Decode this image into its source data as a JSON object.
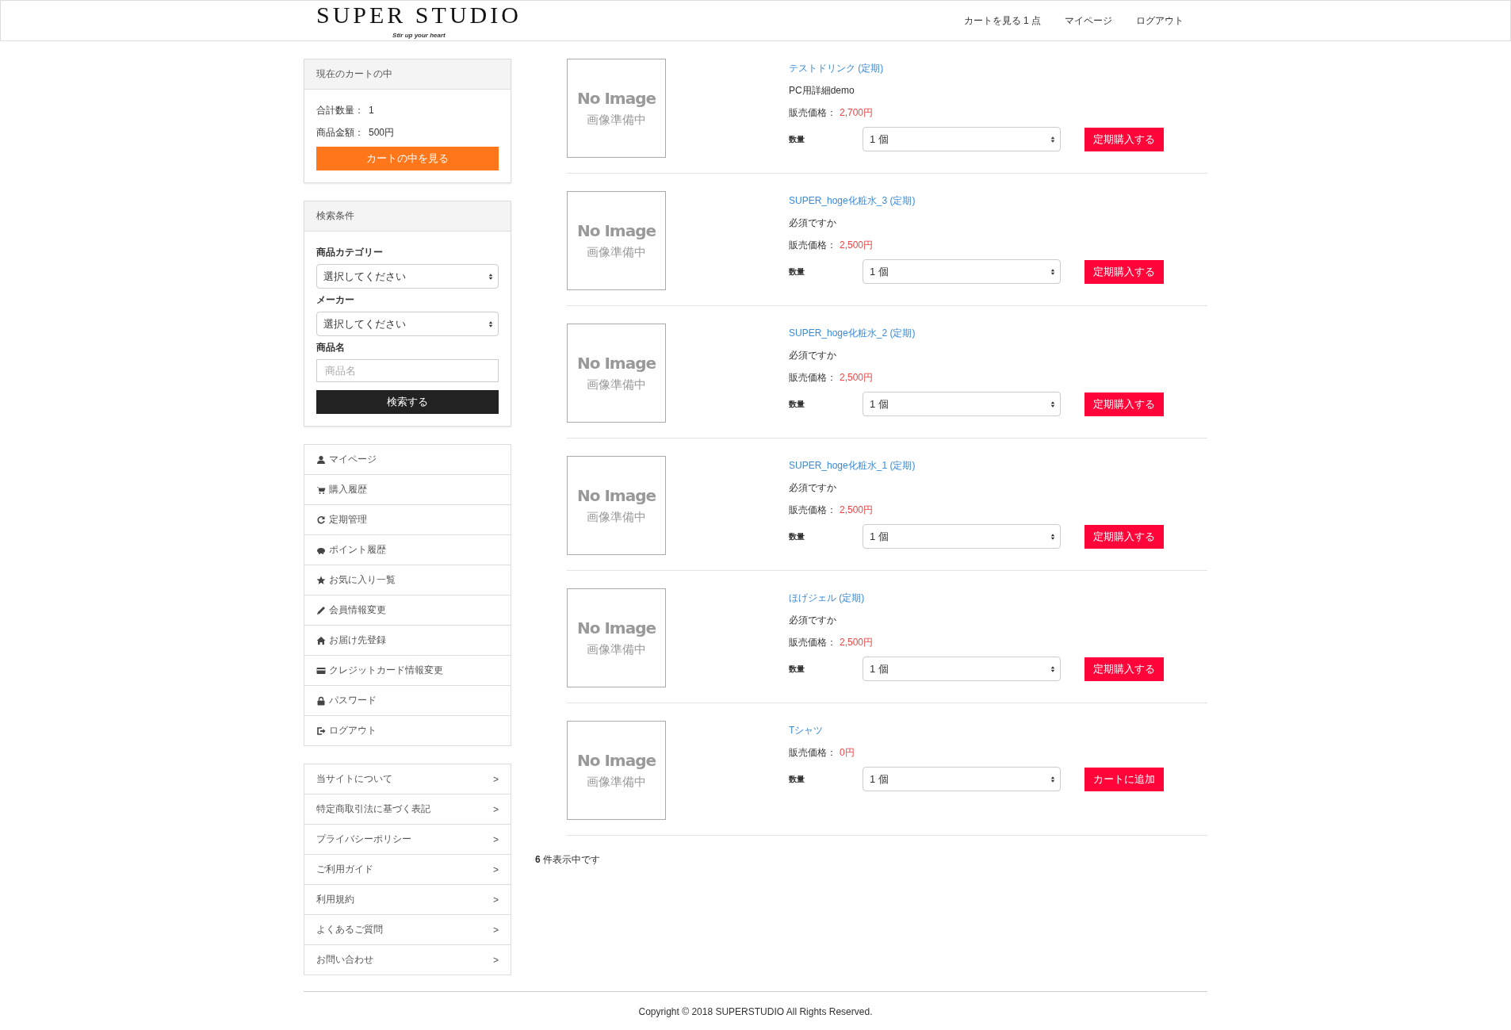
{
  "header": {
    "logo": "SUPER STUDIO",
    "tagline": "Stir up your heart",
    "nav": [
      "カートを見る 1 点",
      "マイページ",
      "ログアウト"
    ]
  },
  "cart": {
    "title": "現在のカートの中",
    "lines": [
      {
        "label": "合計数量：",
        "value": "1"
      },
      {
        "label": "商品金額：",
        "value": "500円"
      }
    ],
    "button": "カートの中を見る"
  },
  "search": {
    "title": "検索条件",
    "fields": [
      {
        "kind": "select",
        "label": "商品カテゴリー",
        "value": "選択してください"
      },
      {
        "kind": "select",
        "label": "メーカー",
        "value": "選択してください"
      },
      {
        "kind": "text",
        "label": "商品名",
        "placeholder": "商品名"
      }
    ],
    "button": "検索する"
  },
  "member_menu": [
    "マイページ",
    "購入履歴",
    "定期管理",
    "ポイント履歴",
    "お気に入り一覧",
    "会員情報変更",
    "お届け先登録",
    "クレジットカード情報変更",
    "パスワード",
    "ログアウト"
  ],
  "info_links": [
    {
      "label": "当サイトについて",
      "arrow": ">"
    },
    {
      "label": "特定商取引法に基づく表記",
      "arrow": ">"
    },
    {
      "label": "プライバシーポリシー",
      "arrow": ">"
    },
    {
      "label": "ご利用ガイド",
      "arrow": ">"
    },
    {
      "label": "利用規約",
      "arrow": ">"
    },
    {
      "label": "よくあるご質問",
      "arrow": ">"
    },
    {
      "label": "お問い合わせ",
      "arrow": ">"
    }
  ],
  "products": [
    {
      "image_text": [
        "No Image",
        "画像準備中"
      ],
      "name": "テストドリンク (定期)",
      "description": "PC用詳細demo",
      "price_label": "販売価格：",
      "price": "2,700円",
      "qty_label": "数量",
      "qty": "1 個",
      "button": "定期購入する"
    },
    {
      "image_text": [
        "No Image",
        "画像準備中"
      ],
      "name": "SUPER_hoge化粧水_3 (定期)",
      "description": "必須ですか",
      "price_label": "販売価格：",
      "price": "2,500円",
      "qty_label": "数量",
      "qty": "1 個",
      "button": "定期購入する"
    },
    {
      "image_text": [
        "No Image",
        "画像準備中"
      ],
      "name": "SUPER_hoge化粧水_2 (定期)",
      "description": "必須ですか",
      "price_label": "販売価格：",
      "price": "2,500円",
      "qty_label": "数量",
      "qty": "1 個",
      "button": "定期購入する"
    },
    {
      "image_text": [
        "No Image",
        "画像準備中"
      ],
      "name": "SUPER_hoge化粧水_1 (定期)",
      "description": "必須ですか",
      "price_label": "販売価格：",
      "price": "2,500円",
      "qty_label": "数量",
      "qty": "1 個",
      "button": "定期購入する"
    },
    {
      "image_text": [
        "No Image",
        "画像準備中"
      ],
      "name": "ほげジェル (定期)",
      "description": "必須ですか",
      "price_label": "販売価格：",
      "price": "2,500円",
      "qty_label": "数量",
      "qty": "1 個",
      "button": "定期購入する"
    },
    {
      "image_text": [
        "No Image",
        "画像準備中"
      ],
      "name": "Tシャツ",
      "price_label": "販売価格：",
      "price": "0円",
      "qty_label": "数量",
      "qty": "1 個",
      "button": "カートに追加"
    }
  ],
  "result_count": "**6** 件表示中です",
  "footer": "Copyright © 2018 SUPERSTUDIO All Rights Reserved."
}
